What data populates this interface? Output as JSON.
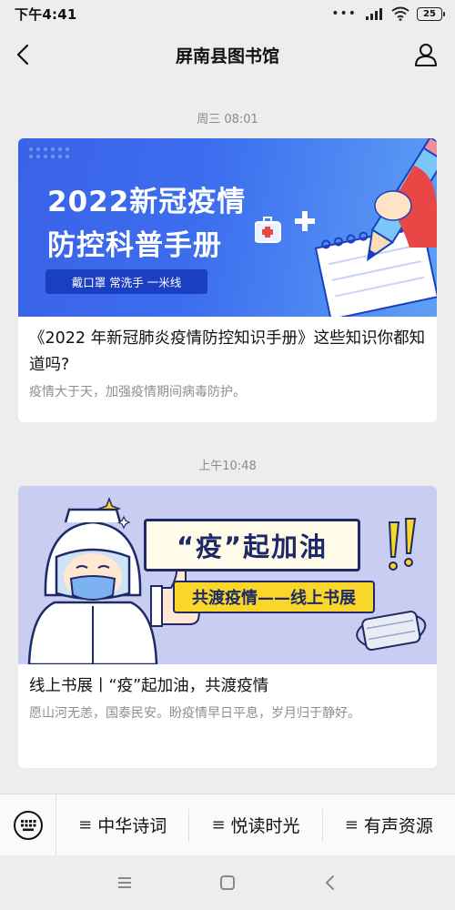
{
  "status_bar": {
    "time": "下午4:41",
    "battery": "25"
  },
  "nav": {
    "title": "屏南县图书馆"
  },
  "messages": [
    {
      "timestamp": "周三 08:01",
      "cover": {
        "line1": "2022新冠疫情",
        "line2": "防控科普手册",
        "tag": "戴口罩 常洗手 一米线"
      },
      "title": "《2022 年新冠肺炎疫情防控知识手册》这些知识你都知道吗?",
      "digest": "疫情大于天，加强疫情期间病毒防护。"
    },
    {
      "timestamp": "上午10:48",
      "cover": {
        "heading": "“疫”起加油",
        "banner": "共渡疫情——线上书展"
      },
      "title": "线上书展丨“疫”起加油，共渡疫情",
      "digest": "愿山河无恙，国泰民安。盼疫情早日平息，岁月归于静好。"
    }
  ],
  "menu": {
    "items": [
      {
        "label": "中华诗词"
      },
      {
        "label": "悦读时光"
      },
      {
        "label": "有声资源"
      }
    ]
  },
  "icons": {
    "back": "back-arrow-icon",
    "profile": "person-icon",
    "keyboard": "keyboard-icon",
    "menu": "menu-lines-icon",
    "signal": "signal-icon",
    "wifi": "wifi-icon",
    "battery": "battery-icon",
    "recent": "recent-apps-icon",
    "home": "home-icon",
    "sys_back": "system-back-icon"
  },
  "colors": {
    "background": "#ededed",
    "accent_blue": "#3d6eef",
    "banner_yellow": "#f8d62a",
    "text_muted": "#8e8e8e"
  }
}
